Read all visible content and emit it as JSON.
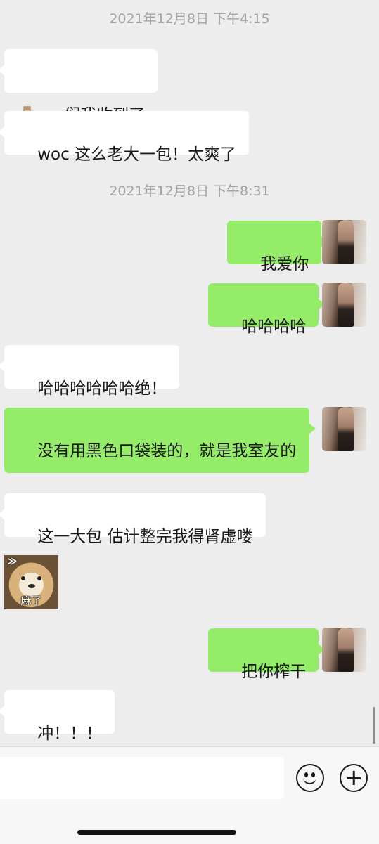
{
  "timestamps": [
    "2021年12月8日 下午4:15",
    "2021年12月8日 下午8:31"
  ],
  "messages": [
    {
      "side": "left",
      "icon": "sock-emoji-icon",
      "text": "们我收到了"
    },
    {
      "side": "left",
      "text": "woc 这么老大一包！太爽了"
    },
    {
      "side": "right",
      "text": "我爱你"
    },
    {
      "side": "right",
      "text": "哈哈哈哈"
    },
    {
      "side": "left",
      "text": "哈哈哈哈哈哈绝！"
    },
    {
      "side": "right",
      "text": "没有用黑色口袋装的，就是我室友的"
    },
    {
      "side": "left",
      "text": "这一大包 估计整完我得肾虚喽"
    },
    {
      "side": "left",
      "type": "sticker",
      "caption": "麻了",
      "sticker_mark": "≫"
    },
    {
      "side": "right",
      "text": "把你榨干"
    },
    {
      "side": "left",
      "text": "冲！！！"
    }
  ],
  "input_bar": {
    "text_value": "",
    "emoji_button": "smiley-face-icon",
    "more_button": "plus-circle-icon"
  },
  "colors": {
    "background": "#ededed",
    "left_bubble": "#ffffff",
    "right_bubble": "#95ec69",
    "timestamp": "#a3a3a3"
  }
}
